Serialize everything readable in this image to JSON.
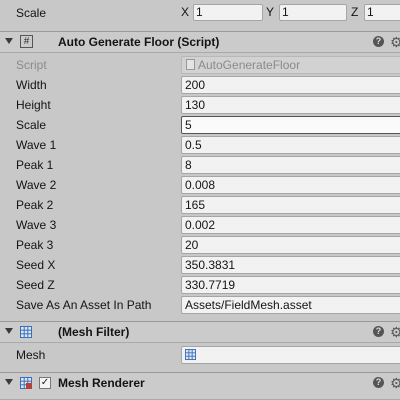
{
  "transform": {
    "scale_label": "Scale",
    "x_label": "X",
    "x_value": "1",
    "y_label": "Y",
    "y_value": "1",
    "z_label": "Z",
    "z_value": "1"
  },
  "auto_generate_floor": {
    "title": "Auto Generate Floor (Script)",
    "script_label": "Script",
    "script_value": "AutoGenerateFloor",
    "fields": [
      {
        "label": "Width",
        "value": "200"
      },
      {
        "label": "Height",
        "value": "130"
      },
      {
        "label": "Scale",
        "value": "5"
      },
      {
        "label": "Wave 1",
        "value": "0.5"
      },
      {
        "label": "Peak 1",
        "value": "8"
      },
      {
        "label": "Wave 2",
        "value": "0.008"
      },
      {
        "label": "Peak 2",
        "value": "165"
      },
      {
        "label": "Wave 3",
        "value": "0.002"
      },
      {
        "label": "Peak 3",
        "value": "20"
      },
      {
        "label": "Seed X",
        "value": "350.3831"
      },
      {
        "label": "Seed Z",
        "value": "330.7719"
      },
      {
        "label": "Save As An Asset In Path",
        "value": "Assets/FieldMesh.asset"
      }
    ]
  },
  "mesh_filter": {
    "title": "(Mesh Filter)",
    "mesh_label": "Mesh",
    "mesh_value": ""
  },
  "mesh_renderer": {
    "title": "Mesh Renderer",
    "enabled_mark": "✓"
  },
  "icons": {
    "help": "?",
    "gear": "⚙",
    "script": "#"
  }
}
